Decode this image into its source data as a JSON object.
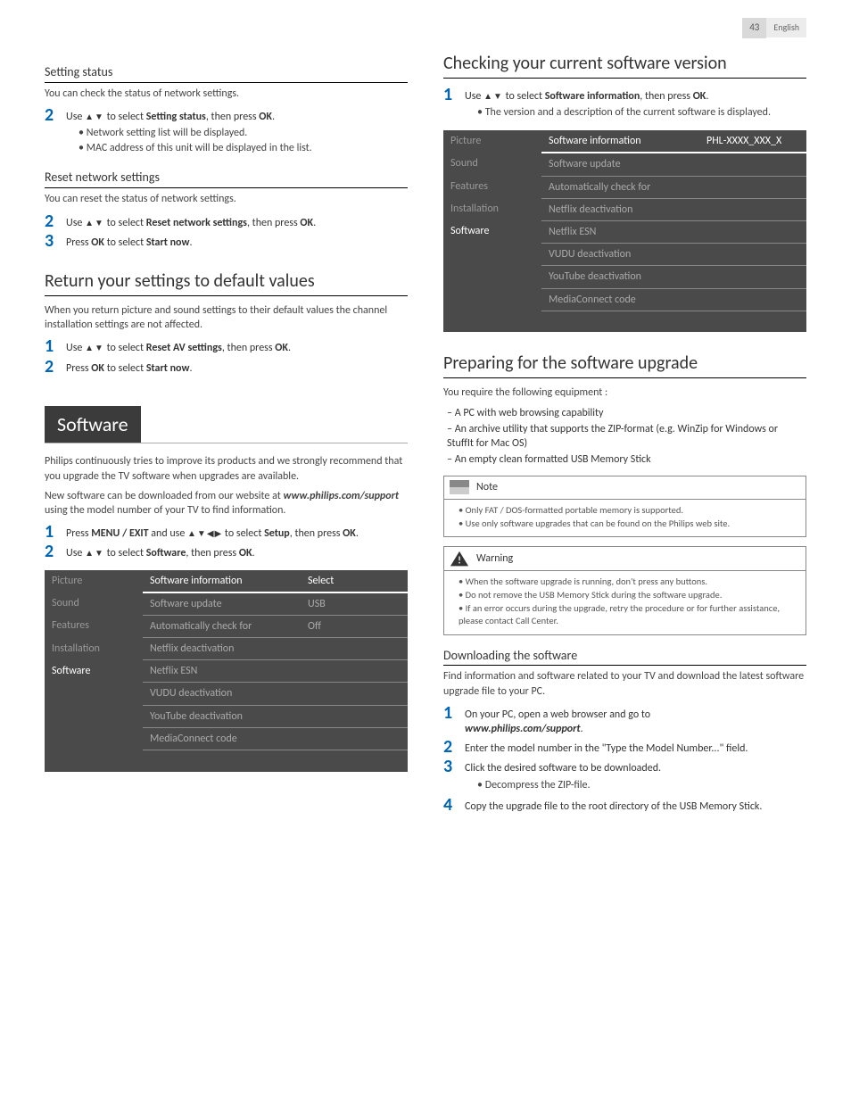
{
  "header": {
    "page": "43",
    "lang": "English"
  },
  "left": {
    "setting_status": {
      "title": "Setting status",
      "desc": "You can check the status of network settings.",
      "step2": [
        "Use ",
        "▲▼",
        " to select ",
        "Setting status",
        ", then press ",
        "OK",
        "."
      ],
      "bul1": "Network setting list will be displayed.",
      "bul2": "MAC address of this unit will be displayed in the list."
    },
    "reset_net": {
      "title": "Reset network settings",
      "desc": "You can reset the status of network settings.",
      "step2": [
        "Use ",
        "▲▼",
        " to select ",
        "Reset network settings",
        ", then press ",
        "OK",
        "."
      ],
      "step3": [
        "Press ",
        "OK",
        " to select ",
        "Start now",
        "."
      ]
    },
    "defaults": {
      "title": "Return your settings to default values",
      "desc": "When you return picture and sound settings to their default values the channel installation settings are not affected.",
      "step1": [
        "Use ",
        "▲▼",
        " to select ",
        "Reset AV settings",
        ", then press ",
        "OK",
        "."
      ],
      "step2": [
        "Press ",
        "OK",
        " to select ",
        "Start now",
        "."
      ]
    },
    "software": {
      "banner": "Software",
      "p1": "Philips continuously tries to improve its products and we strongly recommend that you upgrade the TV software when upgrades are available.",
      "p2a": "New software can be downloaded from our website at ",
      "p2url": "www.philips.com/support",
      "p2b": " using the model number of your TV to find information.",
      "step1": [
        "Press ",
        "MENU / EXIT",
        " and use ",
        "▲▼◀▶",
        " to select ",
        "Setup",
        ", then press ",
        "OK",
        "."
      ],
      "step2": [
        "Use ",
        "▲▼",
        " to select ",
        "Software",
        ", then press ",
        "OK",
        "."
      ]
    },
    "menu": {
      "side": [
        "Picture",
        "Sound",
        "Features",
        "Installation",
        "Software"
      ],
      "side_selected": 4,
      "rows": [
        {
          "label": "Software information",
          "val": "Select",
          "hdr": true
        },
        {
          "label": "Software update",
          "val": "USB"
        },
        {
          "label": "Automatically check for",
          "val": "Off"
        },
        {
          "label": "Netflix deactivation",
          "val": ""
        },
        {
          "label": "Netflix ESN",
          "val": ""
        },
        {
          "label": "VUDU deactivation",
          "val": ""
        },
        {
          "label": "YouTube deactivation",
          "val": ""
        },
        {
          "label": "MediaConnect code",
          "val": ""
        }
      ]
    }
  },
  "right": {
    "check": {
      "title": "Checking your current software version",
      "step1": [
        "Use ",
        "▲▼",
        " to select ",
        "Software information",
        ", then press ",
        "OK",
        "."
      ],
      "bul1": "The version and a description of the current software is displayed."
    },
    "menu": {
      "side": [
        "Picture",
        "Sound",
        "Features",
        "Installation",
        "Software"
      ],
      "side_selected": 4,
      "rows": [
        {
          "label": "Software information",
          "val": "PHL-XXXX_XXX_X",
          "hdr": true
        },
        {
          "label": "Software update",
          "val": ""
        },
        {
          "label": "Automatically check for",
          "val": ""
        },
        {
          "label": "Netflix deactivation",
          "val": ""
        },
        {
          "label": "Netflix ESN",
          "val": ""
        },
        {
          "label": "VUDU deactivation",
          "val": ""
        },
        {
          "label": "YouTube deactivation",
          "val": ""
        },
        {
          "label": "MediaConnect code",
          "val": ""
        }
      ]
    },
    "prep": {
      "title": "Preparing for the software upgrade",
      "desc": "You require the following equipment :",
      "d1": "A PC with web browsing capability",
      "d2": "An archive utility that supports the ZIP-format (e.g. WinZip for Windows or StuffIt for Mac OS)",
      "d3": "An empty clean formatted USB Memory Stick"
    },
    "note": {
      "title": "Note",
      "b1": "Only FAT / DOS-formatted portable memory is supported.",
      "b2": "Use only software upgrades that can be found on the Philips web site."
    },
    "warn": {
      "title": "Warning",
      "b1": "When the software upgrade is running, don't press any buttons.",
      "b2": "Do not remove the USB Memory Stick during the software upgrade.",
      "b3": "If an error occurs during the upgrade, retry the procedure or for further assistance, please contact Call Center."
    },
    "download": {
      "title": "Downloading the software",
      "desc": "Find information and software related to your TV and download the latest software upgrade file to your PC.",
      "step1a": "On your PC, open a web browser and go to ",
      "step1url": "www.philips.com/support",
      "step1b": ".",
      "step2": "Enter the model number in the \"Type the Model Number...\" field.",
      "step3": "Click the desired software to be downloaded.",
      "step3b": "Decompress the ZIP-file.",
      "step4": "Copy the upgrade file to the root directory of the USB Memory Stick."
    }
  }
}
